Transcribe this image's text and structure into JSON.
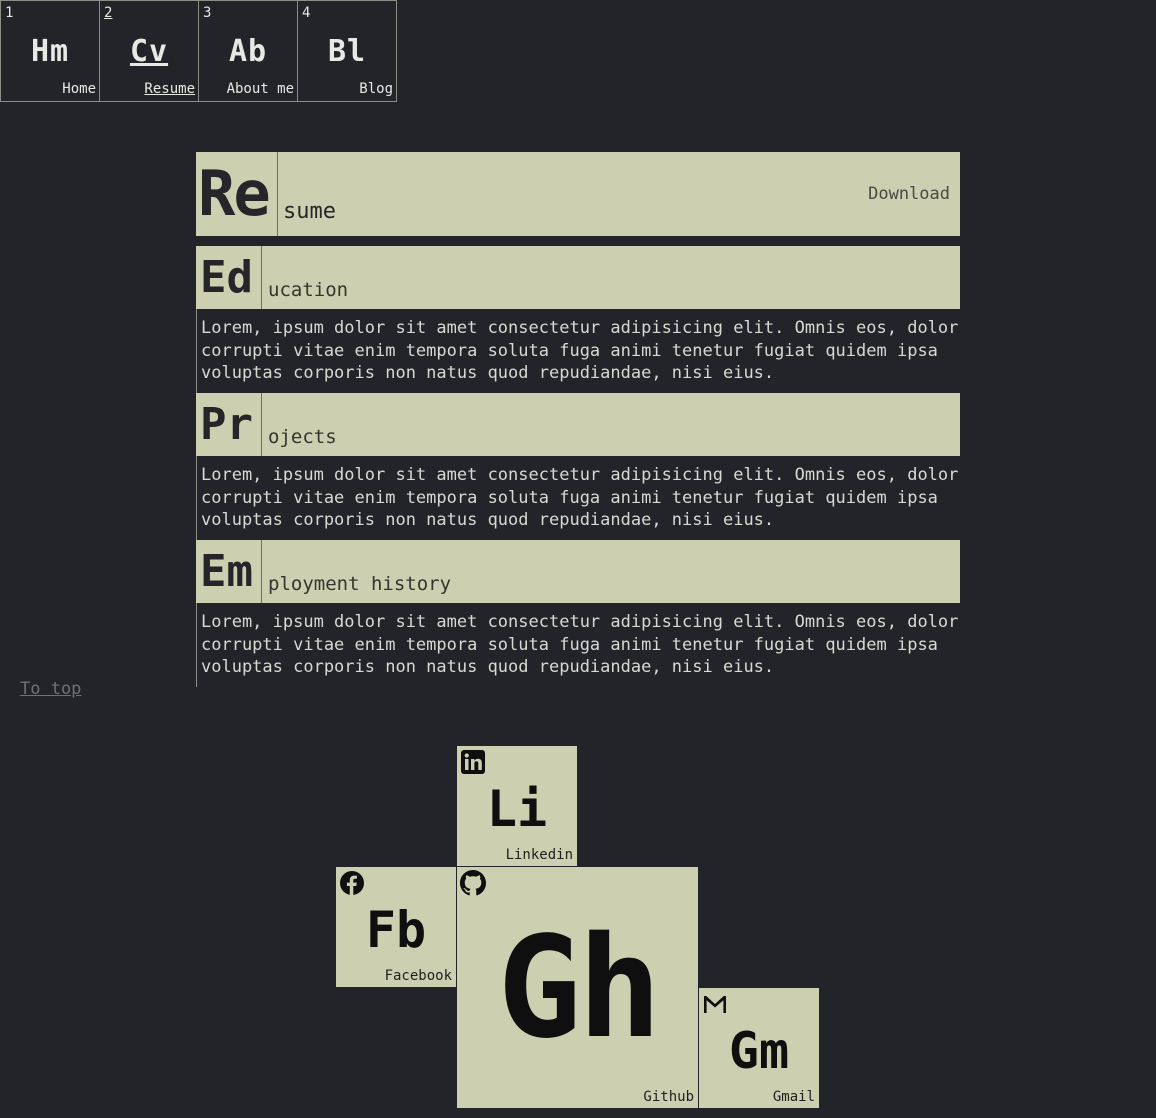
{
  "nav": [
    {
      "num": "1",
      "symbol": "Hm",
      "name": "Home"
    },
    {
      "num": "2",
      "symbol": "Cv",
      "name": "Resume"
    },
    {
      "num": "3",
      "symbol": "Ab",
      "name": "About me"
    },
    {
      "num": "4",
      "symbol": "Bl",
      "name": "Blog"
    }
  ],
  "resume": {
    "symbol": "Re",
    "rest": "sume",
    "download_label": "Download"
  },
  "sections": [
    {
      "symbol": "Ed",
      "rest": "ucation",
      "body": "Lorem, ipsum dolor sit amet consectetur adipisicing elit. Omnis eos, dolor corrupti vitae enim tempora soluta fuga animi tenetur fugiat quidem ipsa voluptas corporis non natus quod repudiandae, nisi eius."
    },
    {
      "symbol": "Pr",
      "rest": "ojects",
      "body": "Lorem, ipsum dolor sit amet consectetur adipisicing elit. Omnis eos, dolor corrupti vitae enim tempora soluta fuga animi tenetur fugiat quidem ipsa voluptas corporis non natus quod repudiandae, nisi eius."
    },
    {
      "symbol": "Em",
      "rest": "ployment history",
      "body": "Lorem, ipsum dolor sit amet consectetur adipisicing elit. Omnis eos, dolor corrupti vitae enim tempora soluta fuga animi tenetur fugiat quidem ipsa voluptas corporis non natus quod repudiandae, nisi eius."
    }
  ],
  "to_top_label": "To top",
  "social": {
    "linkedin": {
      "symbol": "Li",
      "name": "Linkedin",
      "icon": "linkedin-icon"
    },
    "facebook": {
      "symbol": "Fb",
      "name": "Facebook",
      "icon": "facebook-icon"
    },
    "github": {
      "symbol": "Gh",
      "name": "Github",
      "icon": "github-icon"
    },
    "gmail": {
      "symbol": "Gm",
      "name": "Gmail",
      "icon": "gmail-icon"
    }
  },
  "colors": {
    "background": "#232429",
    "tile": "#cccfb0",
    "text": "#d6d6cf"
  }
}
